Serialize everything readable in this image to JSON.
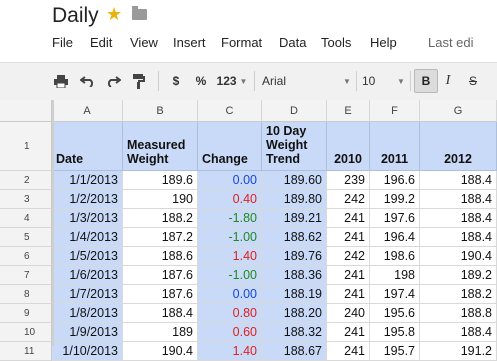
{
  "title": "Daily",
  "icons": {
    "star": "star-icon",
    "folder": "folder-icon"
  },
  "menu": [
    "File",
    "Edit",
    "View",
    "Insert",
    "Format",
    "Data",
    "Tools",
    "Help",
    "Last edi"
  ],
  "toolbar": {
    "print_icon": "print-icon",
    "undo_icon": "undo-icon",
    "redo_icon": "redo-icon",
    "paint_format_icon": "paint-format-icon",
    "currency": "$",
    "percent": "%",
    "number_format": "123",
    "font": "Arial",
    "font_size": "10",
    "bold": "B",
    "italic": "I",
    "strike": "S"
  },
  "columns": [
    "A",
    "B",
    "C",
    "D",
    "E",
    "F",
    "G"
  ],
  "header_row": {
    "row_num": "1",
    "cells": [
      "Date",
      "Measured Weight",
      "Change",
      "10 Day Weight Trend",
      "2010",
      "2011",
      "2012"
    ]
  },
  "rows": [
    {
      "n": "2",
      "cells": [
        "1/1/2013",
        "189.6",
        "0.00",
        "189.60",
        "239",
        "196.6",
        "188.4"
      ],
      "sign": "zero"
    },
    {
      "n": "3",
      "cells": [
        "1/2/2013",
        "190",
        "0.40",
        "189.80",
        "242",
        "199.2",
        "188.4"
      ],
      "sign": "pos"
    },
    {
      "n": "4",
      "cells": [
        "1/3/2013",
        "188.2",
        "-1.80",
        "189.21",
        "241",
        "197.6",
        "188.4"
      ],
      "sign": "neg"
    },
    {
      "n": "5",
      "cells": [
        "1/4/2013",
        "187.2",
        "-1.00",
        "188.62",
        "241",
        "196.4",
        "188.4"
      ],
      "sign": "neg"
    },
    {
      "n": "6",
      "cells": [
        "1/5/2013",
        "188.6",
        "1.40",
        "189.76",
        "242",
        "198.6",
        "190.4"
      ],
      "sign": "pos"
    },
    {
      "n": "7",
      "cells": [
        "1/6/2013",
        "187.6",
        "-1.00",
        "188.36",
        "241",
        "198",
        "189.2"
      ],
      "sign": "neg"
    },
    {
      "n": "8",
      "cells": [
        "1/7/2013",
        "187.6",
        "0.00",
        "188.19",
        "241",
        "197.4",
        "188.2"
      ],
      "sign": "zero"
    },
    {
      "n": "9",
      "cells": [
        "1/8/2013",
        "188.4",
        "0.80",
        "188.20",
        "240",
        "195.6",
        "188.8"
      ],
      "sign": "pos"
    },
    {
      "n": "10",
      "cells": [
        "1/9/2013",
        "189",
        "0.60",
        "188.32",
        "241",
        "195.8",
        "188.4"
      ],
      "sign": "pos"
    },
    {
      "n": "11",
      "cells": [
        "1/10/2013",
        "190.4",
        "1.40",
        "188.67",
        "241",
        "195.7",
        "191.2"
      ],
      "sign": "pos"
    }
  ],
  "colors": {
    "header_fill": "#c9daf8",
    "positive": "#e0201b",
    "negative": "#1e8a1e",
    "zero": "#1a46d6",
    "star": "#e8b30a"
  }
}
